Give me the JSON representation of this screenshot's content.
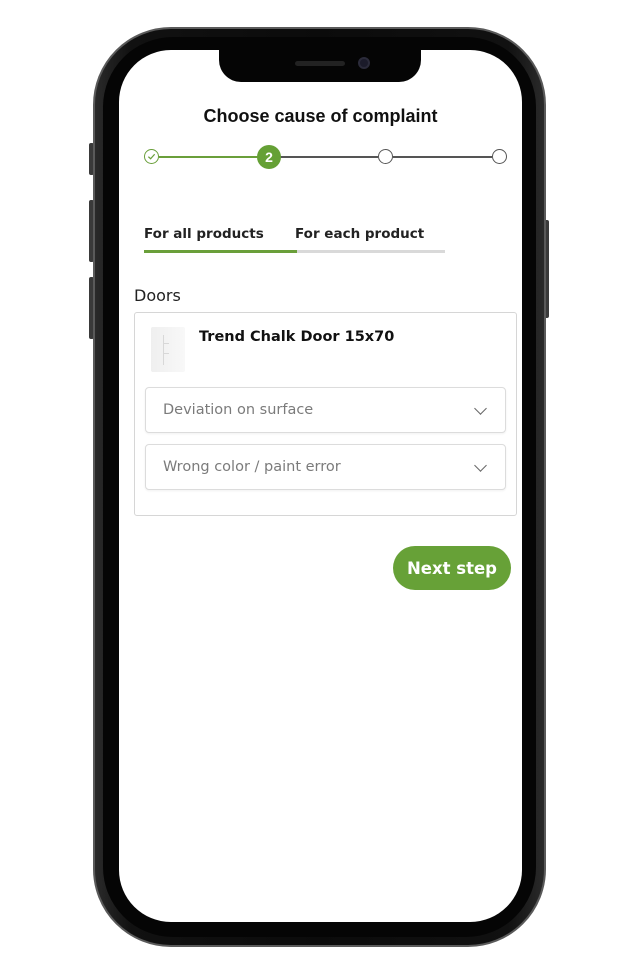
{
  "page": {
    "title": "Choose cause of complaint"
  },
  "stepper": {
    "steps": [
      {
        "state": "completed",
        "icon": "check-icon"
      },
      {
        "state": "active",
        "label": "2"
      },
      {
        "state": "upcoming"
      },
      {
        "state": "upcoming"
      }
    ],
    "active_color": "#65a035"
  },
  "tabs": [
    {
      "label": "For all products",
      "active": true
    },
    {
      "label": "For each product",
      "active": false
    }
  ],
  "section": {
    "label": "Doors",
    "product": {
      "name": "Trend Chalk Door 15x70",
      "thumbnail": "door-thumbnail"
    },
    "causes": [
      {
        "value": "Deviation on surface",
        "icon": "chevron-down-icon"
      },
      {
        "value": "Wrong color / paint error",
        "icon": "chevron-down-icon"
      }
    ]
  },
  "actions": {
    "next_label": "Next step"
  }
}
